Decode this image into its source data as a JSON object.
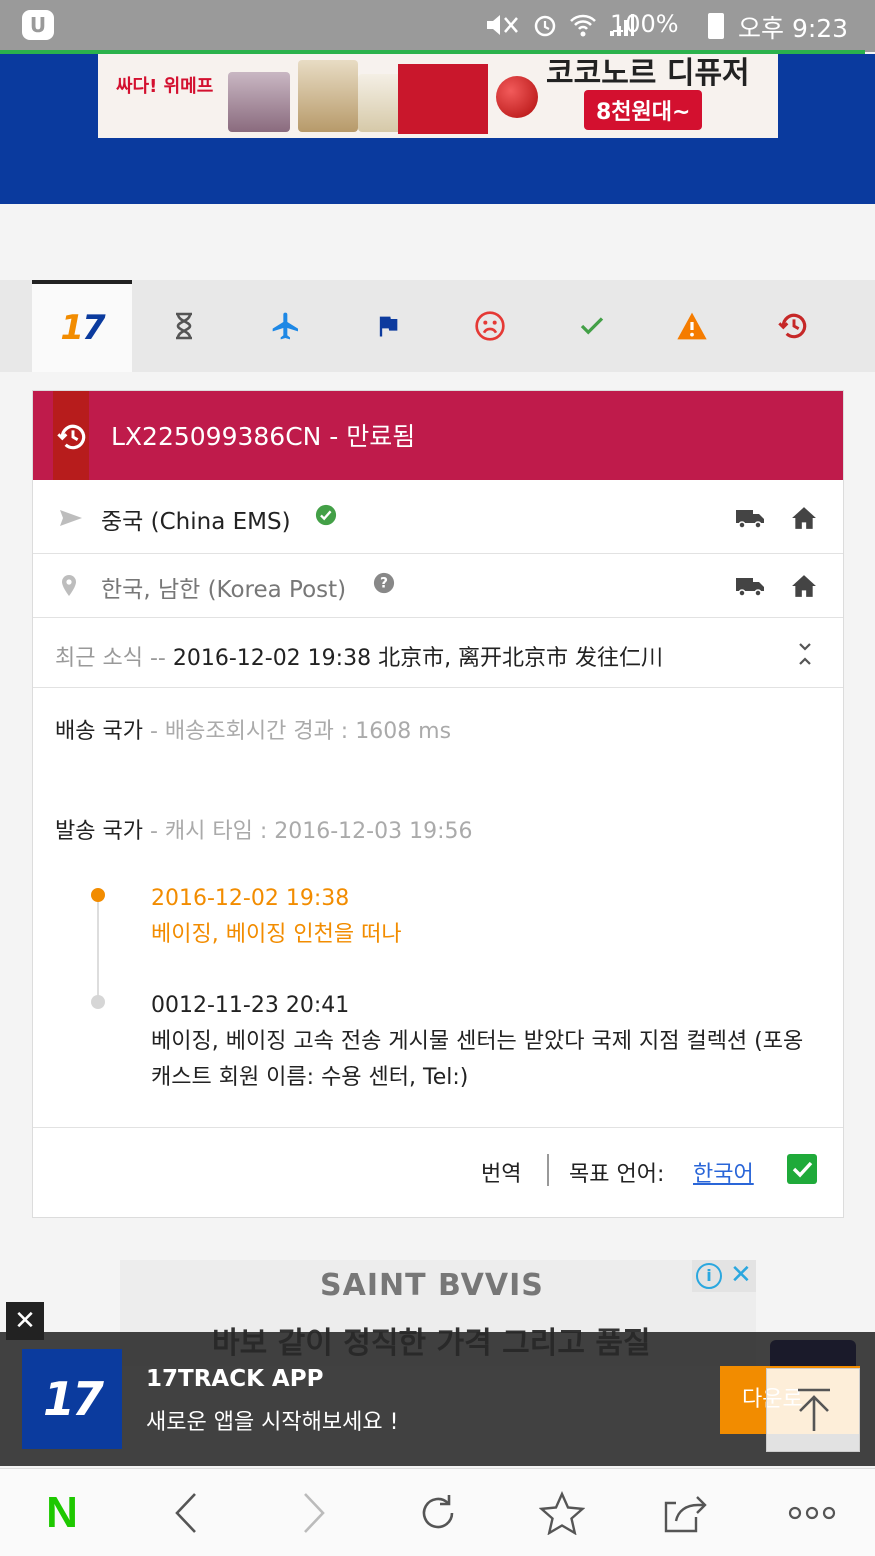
{
  "status_bar": {
    "battery": "100%",
    "time": "오후 9:23"
  },
  "ad_top": {
    "brand": "싸다! 위메프",
    "headline": "코코노르 디퓨저",
    "price": "8천원대~"
  },
  "tabs": [
    {
      "name": "all",
      "icon": "17track-logo-icon",
      "label": "17"
    },
    {
      "name": "not-found",
      "icon": "hourglass-icon"
    },
    {
      "name": "in-transit",
      "icon": "airplane-icon"
    },
    {
      "name": "pickup",
      "icon": "flag-icon"
    },
    {
      "name": "undelivered",
      "icon": "sad-face-icon"
    },
    {
      "name": "delivered",
      "icon": "check-icon"
    },
    {
      "name": "alert",
      "icon": "warning-icon"
    },
    {
      "name": "expired",
      "icon": "history-icon"
    }
  ],
  "tracking": {
    "header": "LX225099386CN - 만료됨",
    "origin": {
      "text": "중국 (China EMS)",
      "verified": true
    },
    "destination": {
      "text": "한국, 남한 (Korea Post)"
    },
    "latest": {
      "label": "최근 소식 -- ",
      "text": "2016-12-02 19:38 北京市, 离开北京市 发往仁川"
    },
    "delivery_country": {
      "label": "배송 국가",
      "sub": " - 배송조회시간 경과 : 1608 ms"
    },
    "sending_country": {
      "label": "발송 국가",
      "sub": " - 캐시 타임 : 2016-12-03 19:56"
    },
    "events": [
      {
        "time": "2016-12-02 19:38",
        "desc": "베이징, 베이징 인천을 떠나"
      },
      {
        "time": "0012-11-23 20:41",
        "desc": "베이징, 베이징 고속 전송 게시물 센터는 받았다 국제 지점 컬렉션 (포옹 캐스트 회원 이름: 수용 센터, Tel:)"
      }
    ],
    "translate_label": "번역",
    "target_lang_label": "목표 언어:",
    "target_lang": "한국어"
  },
  "ad_bottom": {
    "brand": "SAINT BVVIS",
    "slogan": "바보 같이 정직한 가격 그리고 품질"
  },
  "promo": {
    "logo": "17",
    "title": "17TRACK APP",
    "subtitle": "새로운 앱을 시작해보세요 !",
    "button": "다운로"
  },
  "colors": {
    "expired_red": "#bf1b4b",
    "orange": "#f28c00",
    "brand_blue": "#0b3b9e",
    "naver_green": "#1ec800"
  }
}
